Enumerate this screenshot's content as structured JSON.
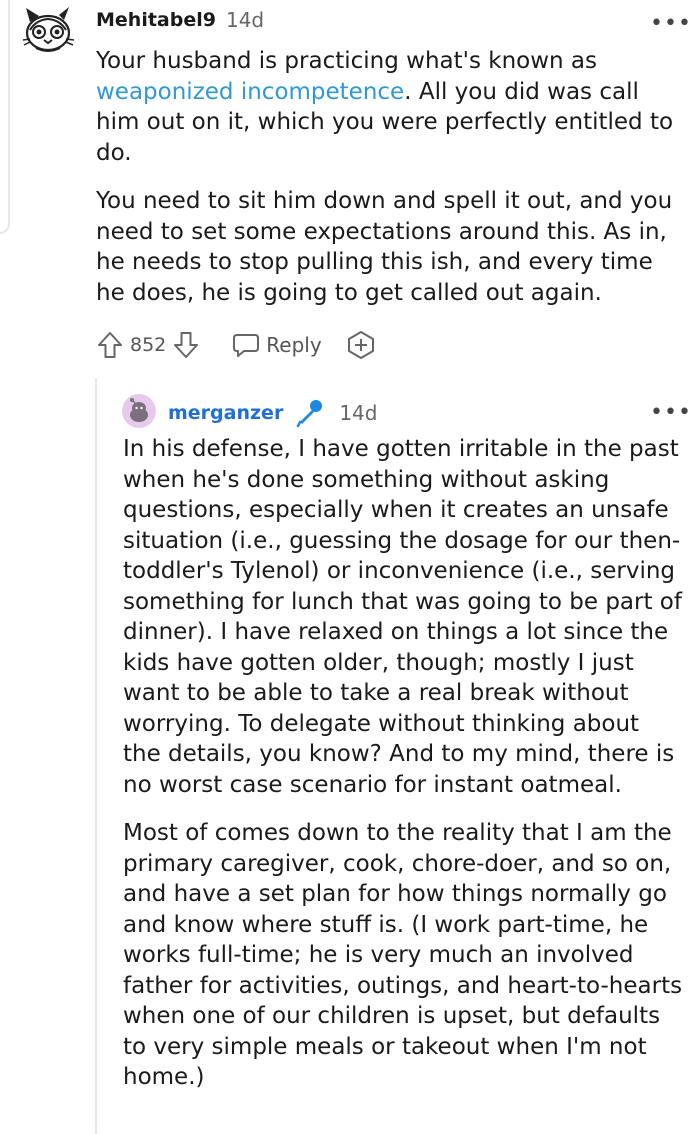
{
  "comment": {
    "author": "Mehitabel9",
    "age": "14d",
    "more_label": "•••",
    "paragraph1_before": "Your husband is practicing what's known as",
    "paragraph1_link": "weaponized incompetence",
    "paragraph1_after": ". All you did was call him out on it, which you were perfectly entitled to do.",
    "paragraph2": "You need to sit him down and spell it out, and you need to set some expectations around this. As in, he needs to stop pulling this ish, and every time he does, he is going to get called out again.",
    "vote_count": "852",
    "reply_label": "Reply"
  },
  "reply": {
    "author": "merganzer",
    "age": "14d",
    "more_label": "•••",
    "paragraph1": "In his defense, I have gotten irritable in the past when he's done something without asking questions, especially when it creates an unsafe situation (i.e., guessing the dosage for our then-toddler's Tylenol) or inconvenience (i.e., serving something for lunch that was going to be part of dinner). I have relaxed on things a lot since the kids have gotten older, though; mostly I just want to be able to take a real break without worrying. To delegate without thinking about the details, you know? And to my mind, there is no worst case scenario for instant oatmeal.",
    "paragraph2": "Most of comes down to the reality that I am the primary caregiver, cook, chore-doer, and so on, and have a set plan for how things normally go and know where stuff is. (I work part-time, he works full-time; he is very much an involved father for activities, outings, and heart-to-hearts when one of our children is upset, but defaults to very simple meals or takeout when I'm not home.)"
  },
  "colors": {
    "link": "#2d9ad6",
    "op_badge": "#1e88e5",
    "reply_username": "#1e6fd9",
    "avatar_bg": "#e7c9ec"
  },
  "icons": {
    "comment_avatar": "cat-avatar-icon",
    "reply_avatar": "snoo-avatar-icon",
    "op_badge": "microphone-icon",
    "upvote": "arrow-up-icon",
    "downvote": "arrow-down-icon",
    "reply": "speech-bubble-icon",
    "award": "award-plus-icon"
  }
}
